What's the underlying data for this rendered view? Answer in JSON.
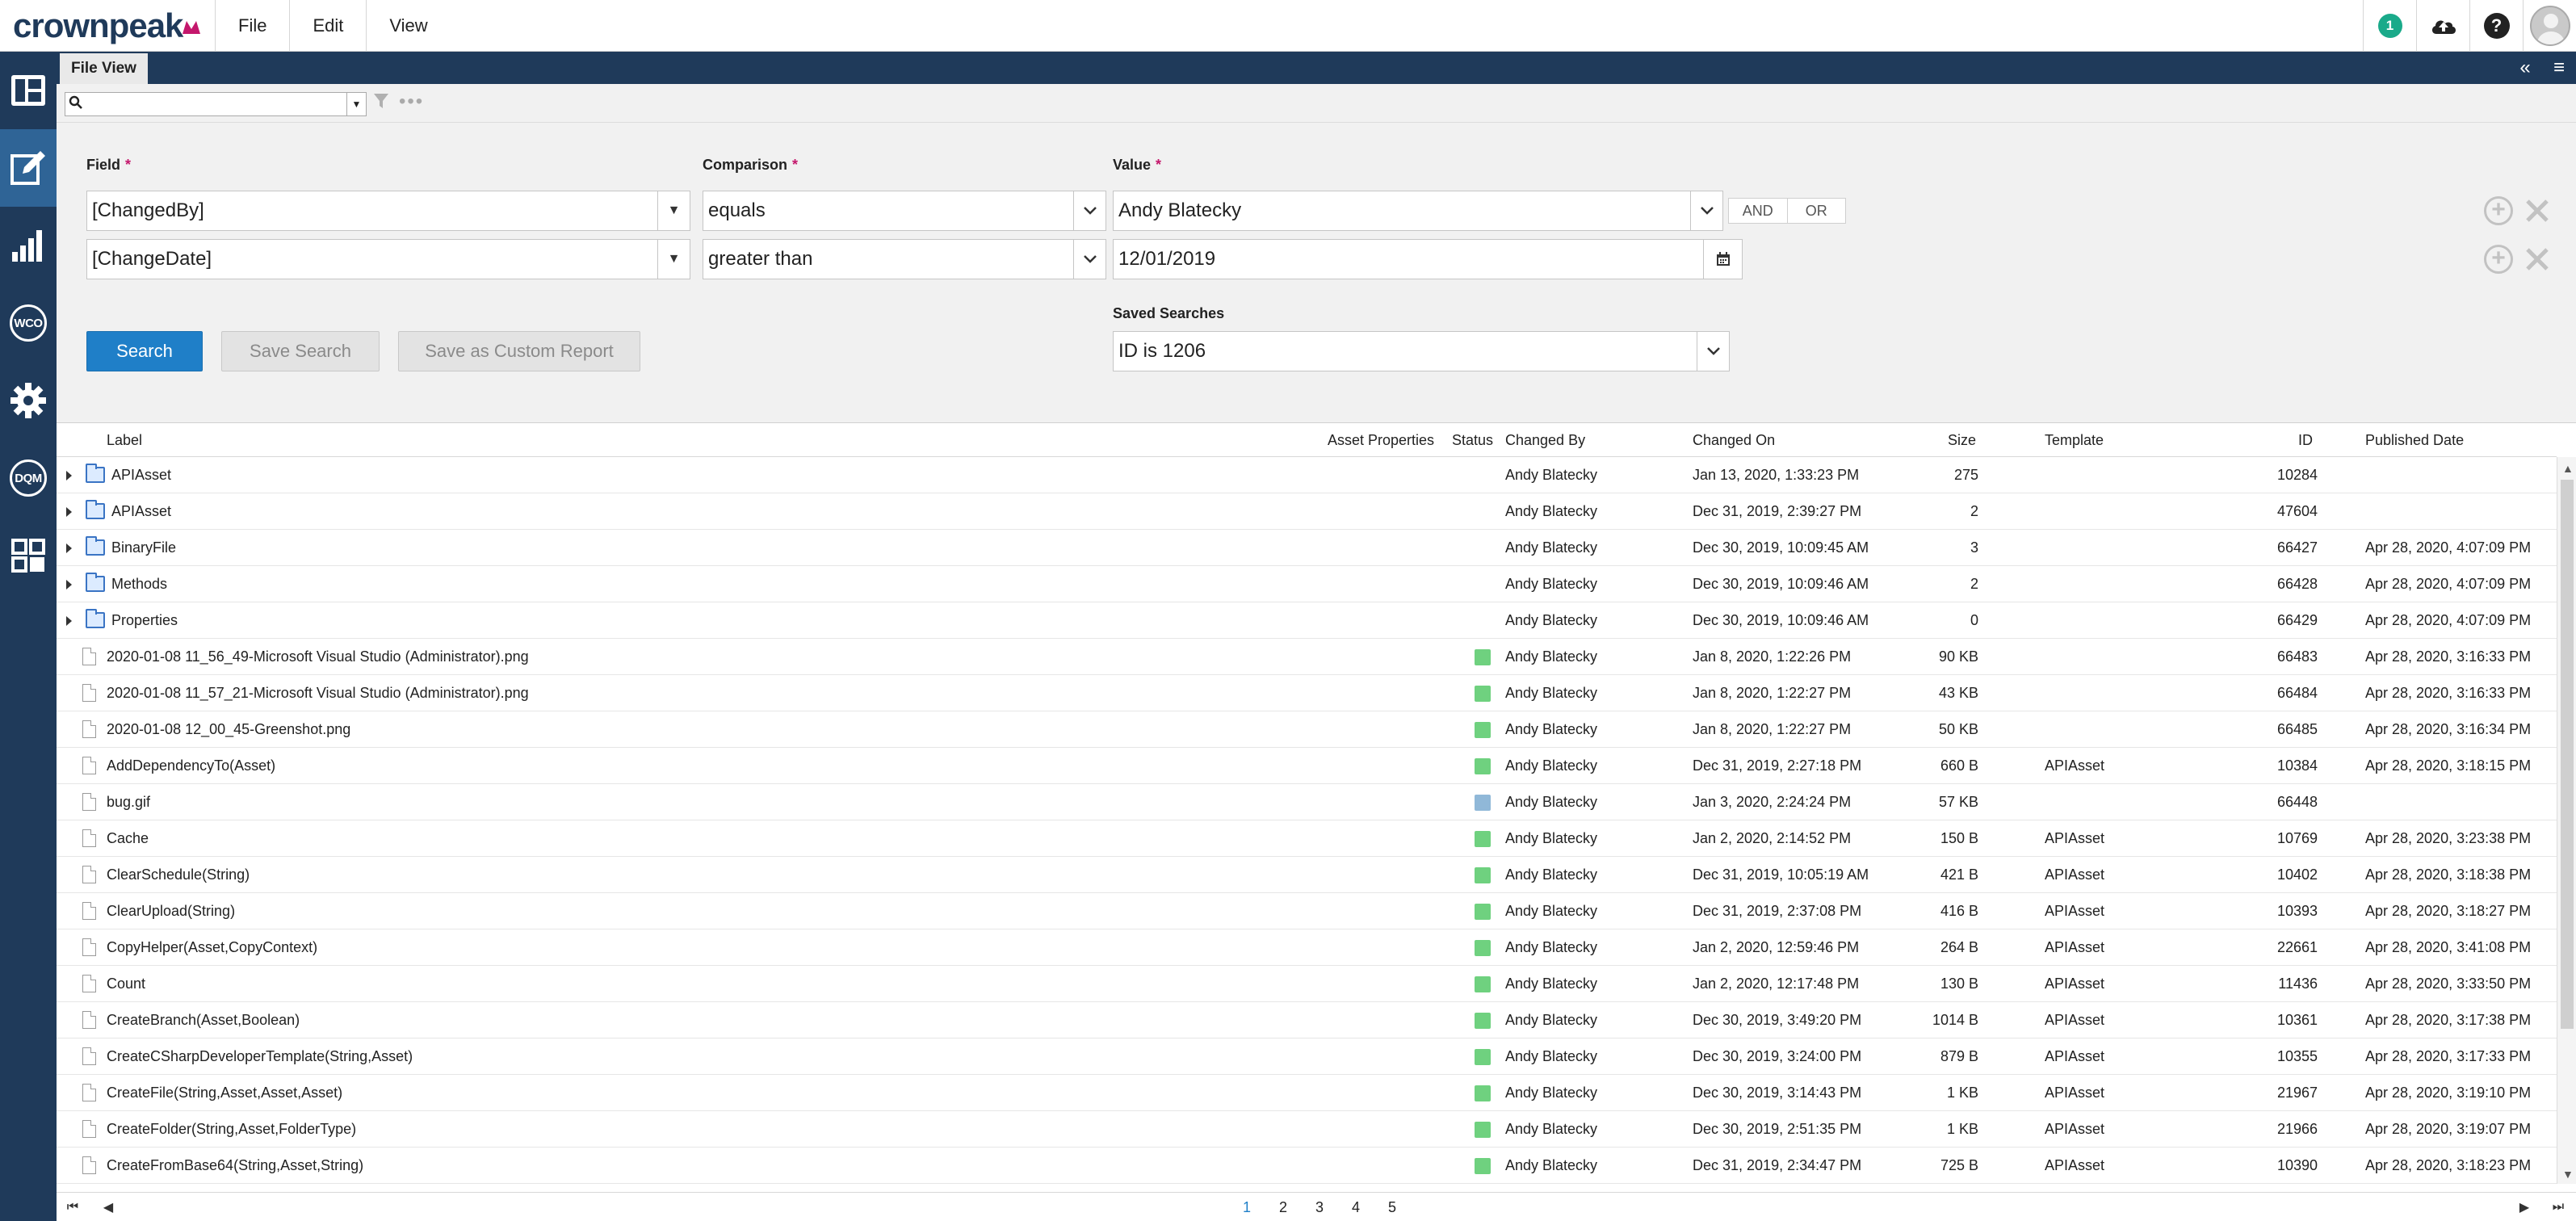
{
  "app": {
    "logo_part1": "crownpeak",
    "logo_part2": ""
  },
  "menu": {
    "file": "File",
    "edit": "Edit",
    "view": "View"
  },
  "topbar": {
    "notification_count": "1",
    "help": "?"
  },
  "tab": {
    "label": "File View"
  },
  "quicksearch": {
    "value": "",
    "placeholder": ""
  },
  "search": {
    "field_label": "Field",
    "comparison_label": "Comparison",
    "value_label": "Value",
    "required_marker": "*",
    "rows": [
      {
        "field": "[ChangedBy]",
        "comparison": "equals",
        "value": "Andy Blatecky"
      },
      {
        "field": "[ChangeDate]",
        "comparison": "greater than",
        "value": "12/01/2019"
      }
    ],
    "and_label": "AND",
    "or_label": "OR",
    "saved_searches_label": "Saved Searches",
    "saved_search_value": "ID is 1206",
    "search_button": "Search",
    "save_search_button": "Save Search",
    "save_custom_report_button": "Save as Custom Report"
  },
  "grid": {
    "columns": {
      "label": "Label",
      "asset_properties": "Asset Properties",
      "status": "Status",
      "changed_by": "Changed By",
      "changed_on": "Changed On",
      "size": "Size",
      "template": "Template",
      "id": "ID",
      "published_date": "Published Date"
    },
    "status_colors": {
      "published": "#6fd17f",
      "draft": "#90b8d8"
    },
    "rows": [
      {
        "kind": "folder",
        "label": "APIAsset",
        "status": "",
        "changed_by": "Andy Blatecky",
        "changed_on": "Jan 13, 2020, 1:33:23 PM",
        "size": "275",
        "template": "",
        "id": "10284",
        "published": ""
      },
      {
        "kind": "folder",
        "label": "APIAsset",
        "status": "",
        "changed_by": "Andy Blatecky",
        "changed_on": "Dec 31, 2019, 2:39:27 PM",
        "size": "2",
        "template": "",
        "id": "47604",
        "published": ""
      },
      {
        "kind": "folder",
        "label": "BinaryFile",
        "status": "",
        "changed_by": "Andy Blatecky",
        "changed_on": "Dec 30, 2019, 10:09:45 AM",
        "size": "3",
        "template": "",
        "id": "66427",
        "published": "Apr 28, 2020, 4:07:09 PM"
      },
      {
        "kind": "folder",
        "label": "Methods",
        "status": "",
        "changed_by": "Andy Blatecky",
        "changed_on": "Dec 30, 2019, 10:09:46 AM",
        "size": "2",
        "template": "",
        "id": "66428",
        "published": "Apr 28, 2020, 4:07:09 PM"
      },
      {
        "kind": "folder",
        "label": "Properties",
        "status": "",
        "changed_by": "Andy Blatecky",
        "changed_on": "Dec 30, 2019, 10:09:46 AM",
        "size": "0",
        "template": "",
        "id": "66429",
        "published": "Apr 28, 2020, 4:07:09 PM"
      },
      {
        "kind": "file",
        "label": "2020-01-08 11_56_49-Microsoft Visual Studio (Administrator).png",
        "status": "published",
        "changed_by": "Andy Blatecky",
        "changed_on": "Jan 8, 2020, 1:22:26 PM",
        "size": "90 KB",
        "template": "",
        "id": "66483",
        "published": "Apr 28, 2020, 3:16:33 PM"
      },
      {
        "kind": "file",
        "label": "2020-01-08 11_57_21-Microsoft Visual Studio (Administrator).png",
        "status": "published",
        "changed_by": "Andy Blatecky",
        "changed_on": "Jan 8, 2020, 1:22:27 PM",
        "size": "43 KB",
        "template": "",
        "id": "66484",
        "published": "Apr 28, 2020, 3:16:33 PM"
      },
      {
        "kind": "file",
        "label": "2020-01-08 12_00_45-Greenshot.png",
        "status": "published",
        "changed_by": "Andy Blatecky",
        "changed_on": "Jan 8, 2020, 1:22:27 PM",
        "size": "50 KB",
        "template": "",
        "id": "66485",
        "published": "Apr 28, 2020, 3:16:34 PM"
      },
      {
        "kind": "file",
        "label": "AddDependencyTo(Asset)",
        "status": "published",
        "changed_by": "Andy Blatecky",
        "changed_on": "Dec 31, 2019, 2:27:18 PM",
        "size": "660 B",
        "template": "APIAsset",
        "id": "10384",
        "published": "Apr 28, 2020, 3:18:15 PM"
      },
      {
        "kind": "file",
        "label": "bug.gif",
        "status": "draft",
        "changed_by": "Andy Blatecky",
        "changed_on": "Jan 3, 2020, 2:24:24 PM",
        "size": "57 KB",
        "template": "",
        "id": "66448",
        "published": ""
      },
      {
        "kind": "file",
        "label": "Cache",
        "status": "published",
        "changed_by": "Andy Blatecky",
        "changed_on": "Jan 2, 2020, 2:14:52 PM",
        "size": "150 B",
        "template": "APIAsset",
        "id": "10769",
        "published": "Apr 28, 2020, 3:23:38 PM"
      },
      {
        "kind": "file",
        "label": "ClearSchedule(String)",
        "status": "published",
        "changed_by": "Andy Blatecky",
        "changed_on": "Dec 31, 2019, 10:05:19 AM",
        "size": "421 B",
        "template": "APIAsset",
        "id": "10402",
        "published": "Apr 28, 2020, 3:18:38 PM"
      },
      {
        "kind": "file",
        "label": "ClearUpload(String)",
        "status": "published",
        "changed_by": "Andy Blatecky",
        "changed_on": "Dec 31, 2019, 2:37:08 PM",
        "size": "416 B",
        "template": "APIAsset",
        "id": "10393",
        "published": "Apr 28, 2020, 3:18:27 PM"
      },
      {
        "kind": "file",
        "label": "CopyHelper(Asset,CopyContext)",
        "status": "published",
        "changed_by": "Andy Blatecky",
        "changed_on": "Jan 2, 2020, 12:59:46 PM",
        "size": "264 B",
        "template": "APIAsset",
        "id": "22661",
        "published": "Apr 28, 2020, 3:41:08 PM"
      },
      {
        "kind": "file",
        "label": "Count",
        "status": "published",
        "changed_by": "Andy Blatecky",
        "changed_on": "Jan 2, 2020, 12:17:48 PM",
        "size": "130 B",
        "template": "APIAsset",
        "id": "11436",
        "published": "Apr 28, 2020, 3:33:50 PM"
      },
      {
        "kind": "file",
        "label": "CreateBranch(Asset,Boolean)",
        "status": "published",
        "changed_by": "Andy Blatecky",
        "changed_on": "Dec 30, 2019, 3:49:20 PM",
        "size": "1014 B",
        "template": "APIAsset",
        "id": "10361",
        "published": "Apr 28, 2020, 3:17:38 PM"
      },
      {
        "kind": "file",
        "label": "CreateCSharpDeveloperTemplate(String,Asset)",
        "status": "published",
        "changed_by": "Andy Blatecky",
        "changed_on": "Dec 30, 2019, 3:24:00 PM",
        "size": "879 B",
        "template": "APIAsset",
        "id": "10355",
        "published": "Apr 28, 2020, 3:17:33 PM"
      },
      {
        "kind": "file",
        "label": "CreateFile(String,Asset,Asset,Asset)",
        "status": "published",
        "changed_by": "Andy Blatecky",
        "changed_on": "Dec 30, 2019, 3:14:43 PM",
        "size": "1 KB",
        "template": "APIAsset",
        "id": "21967",
        "published": "Apr 28, 2020, 3:19:10 PM"
      },
      {
        "kind": "file",
        "label": "CreateFolder(String,Asset,FolderType)",
        "status": "published",
        "changed_by": "Andy Blatecky",
        "changed_on": "Dec 30, 2019, 2:51:35 PM",
        "size": "1 KB",
        "template": "APIAsset",
        "id": "21966",
        "published": "Apr 28, 2020, 3:19:07 PM"
      },
      {
        "kind": "file",
        "label": "CreateFromBase64(String,Asset,String)",
        "status": "published",
        "changed_by": "Andy Blatecky",
        "changed_on": "Dec 31, 2019, 2:34:47 PM",
        "size": "725 B",
        "template": "APIAsset",
        "id": "10390",
        "published": "Apr 28, 2020, 3:18:23 PM"
      }
    ]
  },
  "pager": {
    "pages": [
      "1",
      "2",
      "3",
      "4",
      "5"
    ],
    "current": "1"
  }
}
